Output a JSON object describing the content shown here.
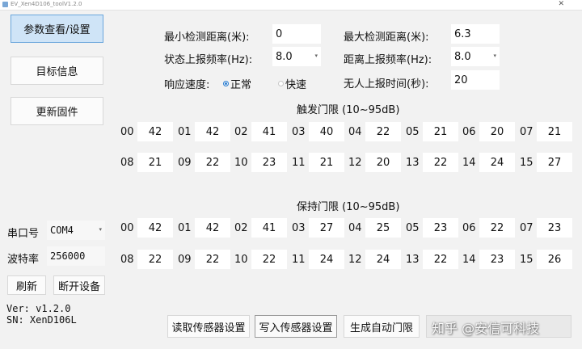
{
  "window": {
    "title": "EV_Xen4D106_toolV1.2.0"
  },
  "sidebar": {
    "params_btn": "参数查看/设置",
    "target_btn": "目标信息",
    "firmware_btn": "更新固件"
  },
  "params": {
    "min_dist_label": "最小检测距离(米):",
    "min_dist_value": "0",
    "max_dist_label": "最大检测距离(米):",
    "max_dist_value": "6.3",
    "state_rate_label": "状态上报频率(Hz):",
    "state_rate_value": "8.0",
    "dist_rate_label": "距离上报频率(Hz):",
    "dist_rate_value": "8.0",
    "response_label": "响应速度:",
    "response_normal": "正常",
    "response_fast": "快速",
    "noperson_label": "无人上报时间(秒):",
    "noperson_value": "20"
  },
  "trigger": {
    "title": "触发门限 (10~95dB)",
    "row1_idx": [
      "00",
      "01",
      "02",
      "03",
      "04",
      "05",
      "06",
      "07"
    ],
    "row1_val": [
      "42",
      "42",
      "41",
      "40",
      "22",
      "21",
      "20",
      "21"
    ],
    "row2_idx": [
      "08",
      "09",
      "10",
      "11",
      "12",
      "13",
      "14",
      "15"
    ],
    "row2_val": [
      "21",
      "22",
      "23",
      "21",
      "20",
      "22",
      "24",
      "27"
    ]
  },
  "hold": {
    "title": "保持门限 (10~95dB)",
    "row1_idx": [
      "00",
      "01",
      "02",
      "03",
      "04",
      "05",
      "06",
      "07"
    ],
    "row1_val": [
      "42",
      "42",
      "41",
      "27",
      "25",
      "23",
      "22",
      "23"
    ],
    "row2_idx": [
      "08",
      "09",
      "10",
      "11",
      "12",
      "13",
      "14",
      "15"
    ],
    "row2_val": [
      "22",
      "22",
      "22",
      "24",
      "24",
      "22",
      "23",
      "26"
    ]
  },
  "serial": {
    "port_label": "串口号",
    "port_value": "COM4",
    "baud_label": "波特率",
    "baud_value": "256000",
    "refresh_btn": "刷新",
    "disconnect_btn": "断开设备"
  },
  "info": {
    "version": "Ver: v1.2.0",
    "sn": "SN: XenD106L"
  },
  "bottom": {
    "read_btn": "读取传感器设置",
    "write_btn": "写入传感器设置",
    "auto_btn": "生成自动门限"
  },
  "watermark": "知乎 @安信可科技"
}
